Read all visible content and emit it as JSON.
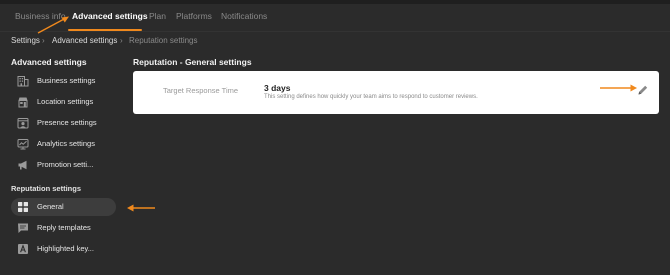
{
  "tabs": [
    {
      "label": "Business info"
    },
    {
      "label": "Advanced settings"
    },
    {
      "label": "Plan"
    },
    {
      "label": "Platforms"
    },
    {
      "label": "Notifications"
    }
  ],
  "active_tab": "Advanced settings",
  "breadcrumb": {
    "items": [
      "Settings",
      "Advanced settings"
    ],
    "current": "Reputation settings",
    "separator": "›"
  },
  "sidebar": {
    "advanced_title": "Advanced settings",
    "advanced_items": [
      {
        "label": "Business settings",
        "icon": "building-icon"
      },
      {
        "label": "Location settings",
        "icon": "storefront-icon"
      },
      {
        "label": "Presence settings",
        "icon": "presence-icon"
      },
      {
        "label": "Analytics settings",
        "icon": "analytics-icon"
      },
      {
        "label": "Promotion setti...",
        "icon": "megaphone-icon"
      }
    ],
    "reputation_title": "Reputation settings",
    "reputation_items": [
      {
        "label": "General",
        "icon": "grid-icon",
        "active": true
      },
      {
        "label": "Reply templates",
        "icon": "chat-icon"
      },
      {
        "label": "Highlighted key...",
        "icon": "letter-a-icon"
      }
    ]
  },
  "main": {
    "title": "Reputation - General settings",
    "setting": {
      "label": "Target Response Time",
      "value": "3 days",
      "description": "This setting defines how quickly your team aims to respond to customer reviews.",
      "action_icon": "pencil-icon"
    }
  },
  "colors": {
    "background": "#2b2b2b",
    "accent": "#f0891d",
    "card": "#ffffff",
    "active_nav": "#3d3d3d"
  }
}
